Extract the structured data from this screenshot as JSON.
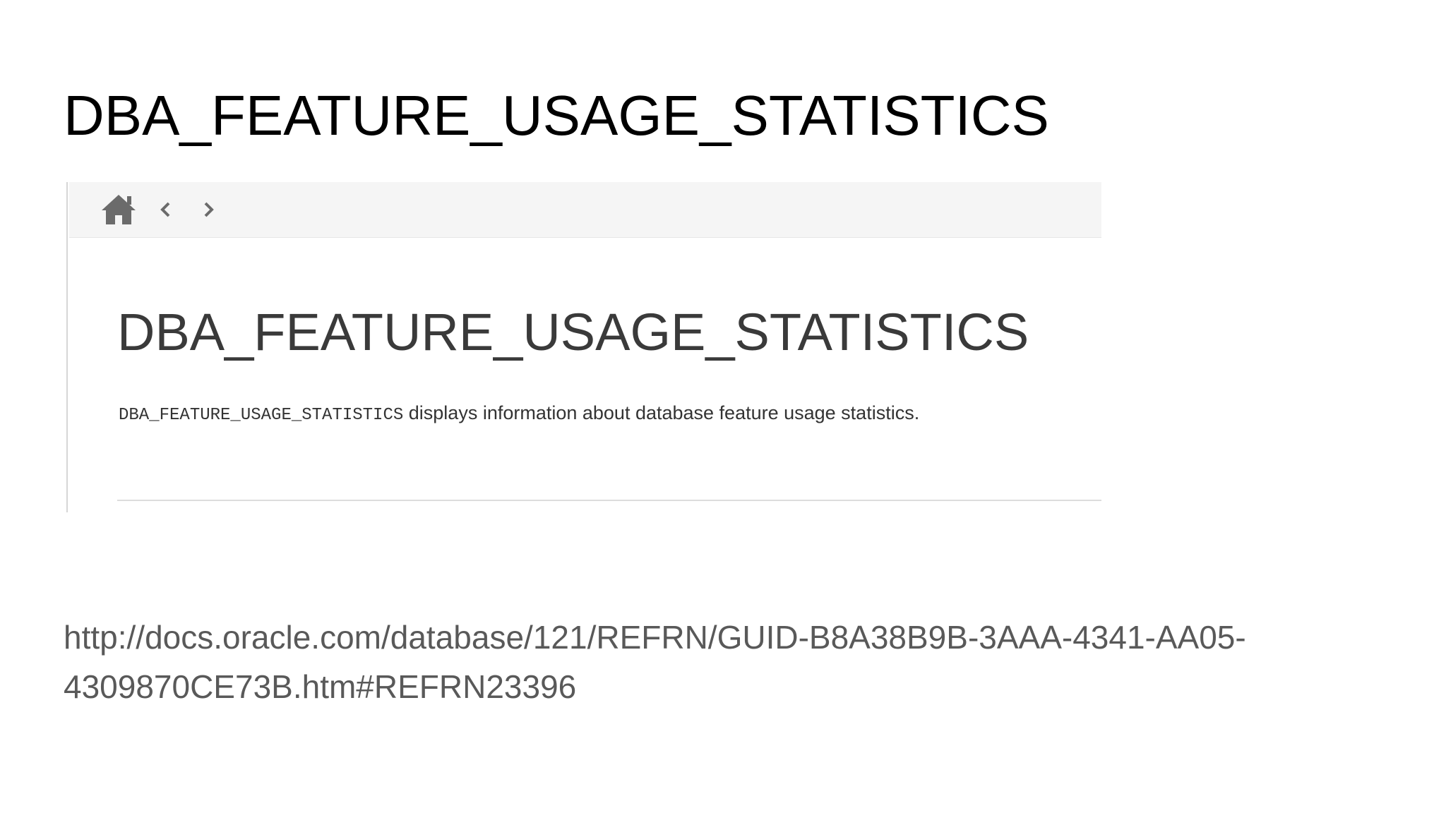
{
  "slide": {
    "title": "DBA_FEATURE_USAGE_STATISTICS",
    "url_line1": "http://docs.oracle.com/database/121/REFRN/GUID-B8A38B9B-3AAA-4341-AA05-",
    "url_line2": "4309870CE73B.htm#REFRN23396"
  },
  "screenshot": {
    "nav": {
      "home_icon": "home-icon",
      "back_icon": "chevron-left-icon",
      "forward_icon": "chevron-right-icon"
    },
    "heading": "DBA_FEATURE_USAGE_STATISTICS",
    "description_code": "DBA_FEATURE_USAGE_STATISTICS",
    "description_text": " displays information about database feature usage statistics."
  },
  "colors": {
    "title": "#000000",
    "heading": "#3a3a3a",
    "url": "#595959",
    "nav_bg": "#f5f5f5",
    "icon": "#6b6b6b"
  }
}
